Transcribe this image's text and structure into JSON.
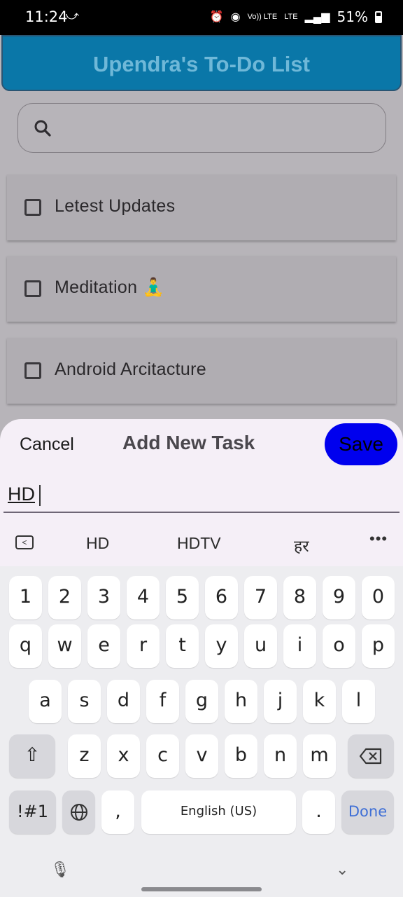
{
  "status_bar": {
    "time": "11:24",
    "left_icon": "missed-call-icon",
    "right_icons": [
      "alarm-icon",
      "hotspot-icon",
      "volte-icon",
      "lte-icon",
      "signal-icon"
    ],
    "volte_label": "Vo)) LTE",
    "lte_label": "LTE",
    "battery": "51%"
  },
  "app_bar": {
    "title": "Upendra's To-Do List",
    "color": "#0a77a8"
  },
  "search": {
    "placeholder": "",
    "value": ""
  },
  "tasks": [
    {
      "label": "Letest Updates",
      "checked": false
    },
    {
      "label": "Meditation 🧘‍♂️",
      "checked": false
    },
    {
      "label": "Android Arcitacture",
      "checked": false
    }
  ],
  "dialog": {
    "cancel_label": "Cancel",
    "title": "Add New Task",
    "save_label": "Save",
    "input_value": "HD"
  },
  "suggestions": [
    "HD",
    "HDTV",
    "हर"
  ],
  "keyboard": {
    "number_row": [
      "1",
      "2",
      "3",
      "4",
      "5",
      "6",
      "7",
      "8",
      "9",
      "0"
    ],
    "row1": [
      "q",
      "w",
      "e",
      "r",
      "t",
      "y",
      "u",
      "i",
      "o",
      "p"
    ],
    "row2": [
      "a",
      "s",
      "d",
      "f",
      "g",
      "h",
      "j",
      "k",
      "l"
    ],
    "row3": [
      "z",
      "x",
      "c",
      "v",
      "b",
      "n",
      "m"
    ],
    "symbols_label": "!#1",
    "comma": ",",
    "space_label": "English (US)",
    "period": ".",
    "done_label": "Done"
  }
}
